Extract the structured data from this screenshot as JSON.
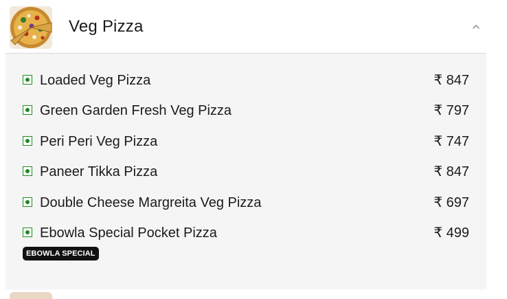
{
  "category": {
    "title": "Veg Pizza",
    "thumbnail_icon": "veg-pizza-thumbnail",
    "collapse_icon": "chevron-up-icon"
  },
  "items": [
    {
      "name": "Loaded Veg Pizza",
      "price": "₹ 847"
    },
    {
      "name": "Green Garden Fresh Veg Pizza",
      "price": "₹ 797"
    },
    {
      "name": "Peri Peri Veg Pizza",
      "price": "₹ 747"
    },
    {
      "name": "Paneer Tikka Pizza",
      "price": "₹ 847"
    },
    {
      "name": "Double Cheese Margreita Veg Pizza",
      "price": "₹ 697"
    },
    {
      "name": "Ebowla Special Pocket Pizza",
      "price": "₹ 499",
      "badge": "EBOWLA SPECIAL"
    }
  ],
  "colors": {
    "veg_green": "#1d8a1d",
    "list_background": "#f5f5f5",
    "badge_background": "#111111"
  }
}
